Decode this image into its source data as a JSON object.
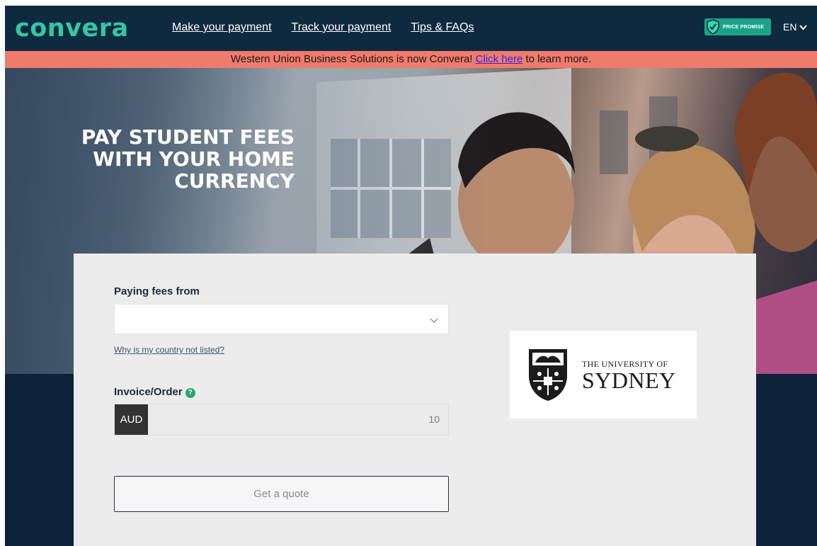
{
  "header": {
    "logo": "convera",
    "nav": [
      "Make your payment",
      "Track your payment",
      "Tips & FAQs"
    ],
    "price_promise": "PRICE PROMISE",
    "language": "EN"
  },
  "banner": {
    "before": "Western Union Business Solutions is now Convera! ",
    "link": "Click here",
    "after": " to learn more."
  },
  "hero": {
    "title_lines": [
      "PAY STUDENT FEES",
      "WITH YOUR HOME",
      "CURRENCY"
    ]
  },
  "form": {
    "paying_from_label": "Paying fees from",
    "paying_from_value": "",
    "country_help_link": "Why is my country not listed?",
    "invoice_label": "Invoice/Order",
    "currency": "AUD",
    "amount": "10",
    "quote_button": "Get a quote"
  },
  "university": {
    "line1": "THE UNIVERSITY OF",
    "line2": "SYDNEY"
  },
  "colors": {
    "header_bg": "#0e2a3f",
    "brand_teal": "#34c6a7",
    "banner_bg": "#ef7b6c",
    "link_blue": "#3b21e6",
    "help_green": "#2aa56d"
  }
}
